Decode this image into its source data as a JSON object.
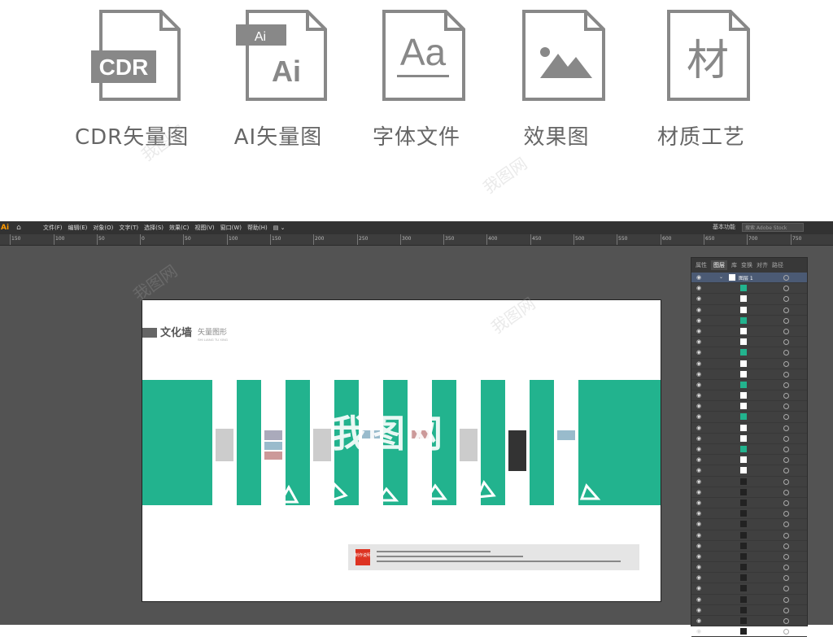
{
  "formats": [
    {
      "icon": "cdr-file-icon",
      "badge": "CDR",
      "caption": "CDR矢量图"
    },
    {
      "icon": "ai-file-icon",
      "badge": "Ai",
      "caption": "AI矢量图"
    },
    {
      "icon": "font-file-icon",
      "badge": "Aa",
      "caption": "字体文件"
    },
    {
      "icon": "image-file-icon",
      "badge": "",
      "caption": "效果图"
    },
    {
      "icon": "material-file-icon",
      "badge": "材",
      "caption": "材质工艺"
    }
  ],
  "app": {
    "logo": "Ai",
    "menu": [
      "文件(F)",
      "编辑(E)",
      "对象(O)",
      "文字(T)",
      "选择(S)",
      "效果(C)",
      "视图(V)",
      "窗口(W)",
      "帮助(H)"
    ],
    "workspace": "基本功能",
    "search_placeholder": "搜索 Adobe Stock"
  },
  "ruler": [
    "150",
    "100",
    "50",
    "0",
    "50",
    "100",
    "150",
    "200",
    "250",
    "300",
    "350",
    "400",
    "450",
    "500",
    "550",
    "600",
    "650",
    "700",
    "750"
  ],
  "artboard": {
    "title": "文化墙",
    "subtitle": "矢量图形",
    "subtitle_pinyin": "SHI LIANG TU XING",
    "big_text": "我图网",
    "note_title": "制作说明",
    "accent": "#22b38e"
  },
  "layers_panel": {
    "tabs": [
      "属性",
      "图层",
      "库",
      "变换",
      "对齐",
      "路径"
    ],
    "active_tab": "图层",
    "top_layer": "图层 1"
  }
}
